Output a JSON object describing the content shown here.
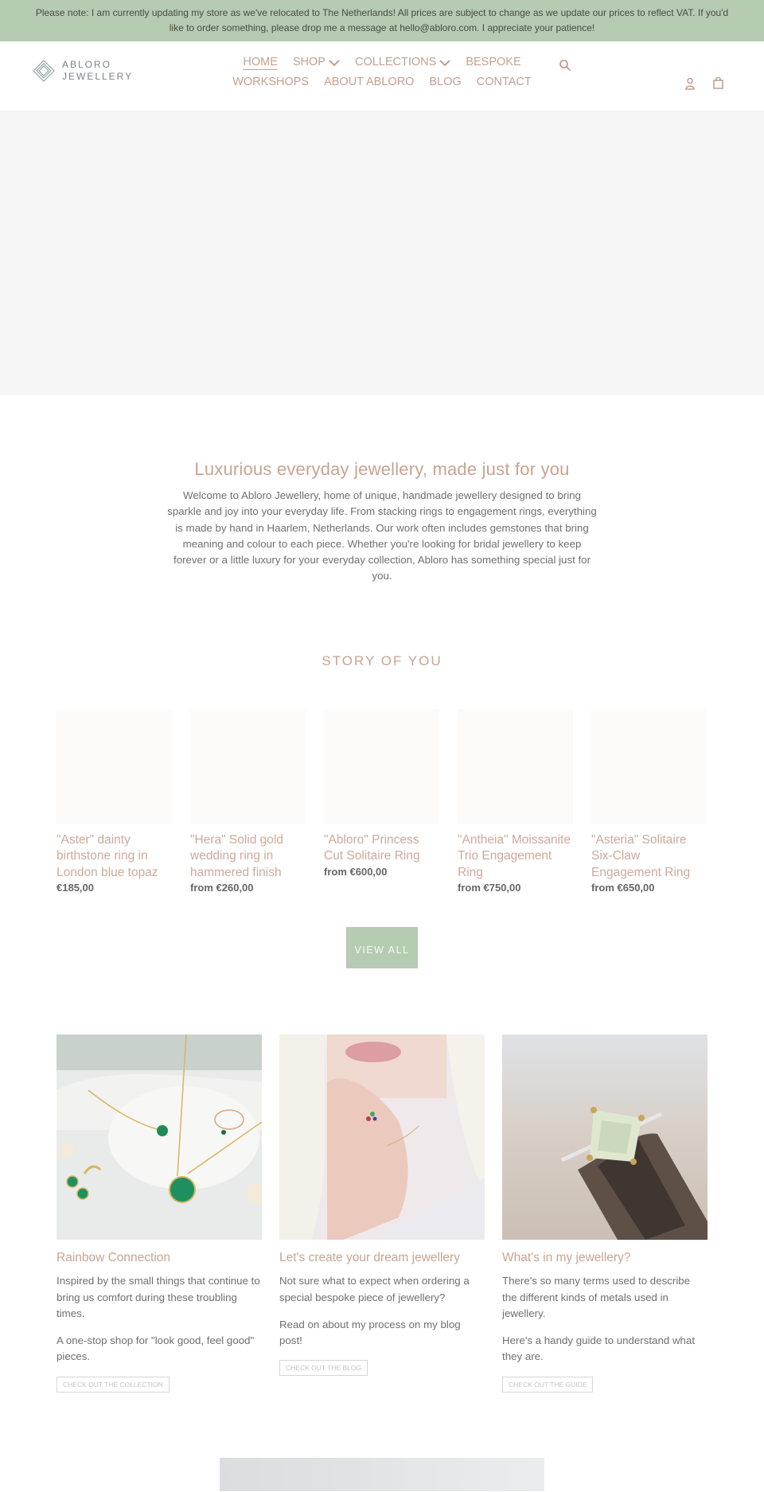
{
  "announcement": {
    "text": "Please note: I am currently updating my store as we've relocated to The Netherlands! All prices are subject to change as we update our prices to reflect VAT. If you'd like to order something, please drop me a message at hello@abloro.com. I appreciate your patience!"
  },
  "header": {
    "logo": {
      "line1": "ABLORO",
      "line2": "JEWELLERY",
      "icon": "diamond-logo-icon"
    },
    "nav_row1": [
      {
        "label": "HOME",
        "active": true,
        "dropdown": false
      },
      {
        "label": "SHOP",
        "active": false,
        "dropdown": true
      },
      {
        "label": "COLLECTIONS",
        "active": false,
        "dropdown": true
      },
      {
        "label": "BESPOKE",
        "active": false,
        "dropdown": false
      }
    ],
    "nav_row2": [
      {
        "label": "WORKSHOPS"
      },
      {
        "label": "ABOUT ABLORO"
      },
      {
        "label": "BLOG"
      },
      {
        "label": "CONTACT"
      }
    ],
    "icons": {
      "search": "search-icon",
      "account": "user-icon",
      "cart": "cart-icon"
    }
  },
  "intro": {
    "title": "Luxurious everyday jewellery, made just for you",
    "body": "Welcome to Abloro Jewellery, home of unique, handmade jewellery designed to bring sparkle and joy into your everyday life. From stacking rings to engagement rings, everything is made by hand in Haarlem, Netherlands. Our work often includes gemstones that bring meaning and colour to each piece. Whether you're looking for bridal jewellery to keep forever or a little luxury for your everyday collection, Abloro has something special just for you."
  },
  "collection": {
    "title": "STORY OF YOU",
    "products": [
      {
        "name": "\"Aster\" dainty birthstone ring in London blue topaz",
        "price": "€185,00"
      },
      {
        "name": "\"Hera\" Solid gold wedding ring in hammered finish",
        "price": "from €260,00"
      },
      {
        "name": "\"Abloro\" Princess Cut Solitaire Ring",
        "price": "from €600,00"
      },
      {
        "name": "\"Antheia\" Moissanite Trio Engagement Ring",
        "price": "from €750,00"
      },
      {
        "name": "\"Asteria\" Solitaire Six-Claw Engagement Ring",
        "price": "from €650,00"
      }
    ],
    "view_all_label": "VIEW ALL"
  },
  "features": [
    {
      "title": "Rainbow Connection",
      "paragraphs": [
        "Inspired by the small things that continue to bring us comfort during these troubling times.",
        "A one-stop shop for \"look good, feel good\" pieces."
      ],
      "button": "CHECK OUT THE COLLECTION",
      "image": "green gemstone jewellery set on white dish"
    },
    {
      "title": "Let's create your dream jewellery",
      "paragraphs": [
        "Not sure what to expect when ordering a special bespoke piece of jewellery?",
        "Read on about my process on my blog post!"
      ],
      "button": "CHECK OUT THE BLOG",
      "image": "woman wearing gemstone ring"
    },
    {
      "title": "What's in my jewellery?",
      "paragraphs": [
        "There's so many terms used to describe the different kinds of metals used in jewellery.",
        "Here's a handy guide to understand what they are."
      ],
      "button": "CHECK OUT THE GUIDE",
      "image": "princess cut ring on wood"
    }
  ],
  "colors": {
    "accent_green": "#b5cbb2",
    "accent_rose": "#c9a391",
    "text": "#6f6f6f"
  }
}
